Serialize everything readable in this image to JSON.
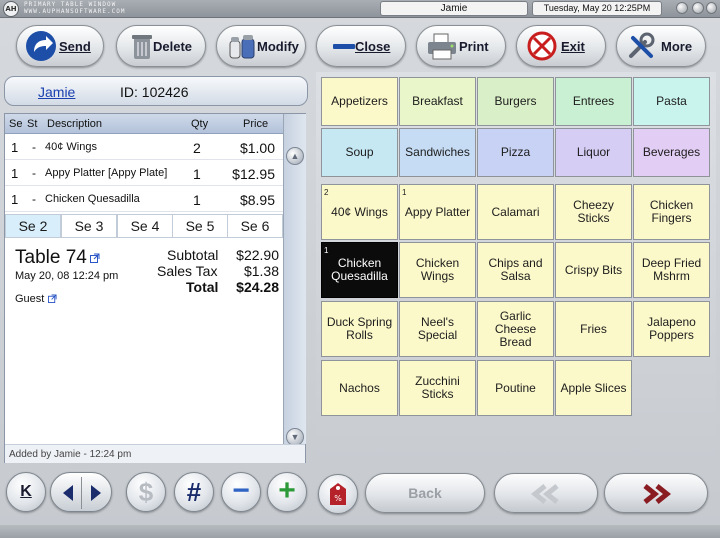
{
  "titlebar": {
    "app_title_line1": "PRIMARY TABLE WINDOW",
    "app_title_line2": "WWW.AUPHANSOFTWARE.COM",
    "user": "Jamie",
    "datetime": "Tuesday, May 20  12:25PM"
  },
  "toolbar": {
    "send": "Send",
    "delete": "Delete",
    "modify": "Modify",
    "close": "Close",
    "print": "Print",
    "exit": "Exit",
    "more": "More"
  },
  "server": {
    "name": "Jamie",
    "id": "ID: 102426"
  },
  "check": {
    "headers": {
      "seat": "Se",
      "status": "St",
      "description": "Description",
      "qty": "Qty",
      "price": "Price"
    },
    "items": [
      {
        "seat": "1",
        "status": "-",
        "description": "40¢ Wings",
        "qty": "2",
        "price": "$1.00"
      },
      {
        "seat": "1",
        "status": "-",
        "description": "Appy Platter [Appy Plate]",
        "qty": "1",
        "price": "$12.95"
      },
      {
        "seat": "1",
        "status": "-",
        "description": "Chicken Quesadilla",
        "qty": "1",
        "price": "$8.95"
      }
    ],
    "seat_tabs": [
      "Se 2",
      "Se 3",
      "Se 4",
      "Se 5",
      "Se 6"
    ],
    "table": "Table 74",
    "opened": "May 20, 08 12:24 pm",
    "guest": "Guest",
    "subtotal_label": "Subtotal",
    "subtotal": "$22.90",
    "tax_label": "Sales Tax",
    "tax": "$1.38",
    "total_label": "Total",
    "total": "$24.28",
    "added_by": "Added by Jamie - 12:24 pm"
  },
  "bottom": {
    "k_label": "K",
    "dollar": "$",
    "hash": "#",
    "minus": "−",
    "plus": "+",
    "back": "Back",
    "coupon": "%"
  },
  "categories": [
    {
      "label": "Appetizers",
      "color": "#fbf8c9"
    },
    {
      "label": "Breakfast",
      "color": "#e9f6c9"
    },
    {
      "label": "Burgers",
      "color": "#d9efc7"
    },
    {
      "label": "Entrees",
      "color": "#c9f0d2"
    },
    {
      "label": "Pasta",
      "color": "#c9f4ee"
    },
    {
      "label": "Soup",
      "color": "#c6e8f3"
    },
    {
      "label": "Sandwiches",
      "color": "#c6dcf4"
    },
    {
      "label": "Pizza",
      "color": "#c8d2f4"
    },
    {
      "label": "Liquor",
      "color": "#d6cdf4"
    },
    {
      "label": "Beverages",
      "color": "#e2cdf4"
    }
  ],
  "menu_items": [
    {
      "label": "40¢ Wings",
      "count": "2"
    },
    {
      "label": "Appy Platter",
      "count": "1"
    },
    {
      "label": "Calamari",
      "count": ""
    },
    {
      "label": "Cheezy Sticks",
      "count": ""
    },
    {
      "label": "Chicken Fingers",
      "count": ""
    },
    {
      "label": "Chicken Quesadilla",
      "count": "1"
    },
    {
      "label": "Chicken Wings",
      "count": ""
    },
    {
      "label": "Chips and Salsa",
      "count": ""
    },
    {
      "label": "Crispy Bits",
      "count": ""
    },
    {
      "label": "Deep Fried Mshrm",
      "count": ""
    },
    {
      "label": "Duck Spring Rolls",
      "count": ""
    },
    {
      "label": "Neel's Special",
      "count": ""
    },
    {
      "label": "Garlic Cheese Bread",
      "count": ""
    },
    {
      "label": "Fries",
      "count": ""
    },
    {
      "label": "Jalapeno Poppers",
      "count": ""
    },
    {
      "label": "Nachos",
      "count": ""
    },
    {
      "label": "Zucchini Sticks",
      "count": ""
    },
    {
      "label": "Poutine",
      "count": ""
    },
    {
      "label": "Apple Slices",
      "count": ""
    }
  ]
}
